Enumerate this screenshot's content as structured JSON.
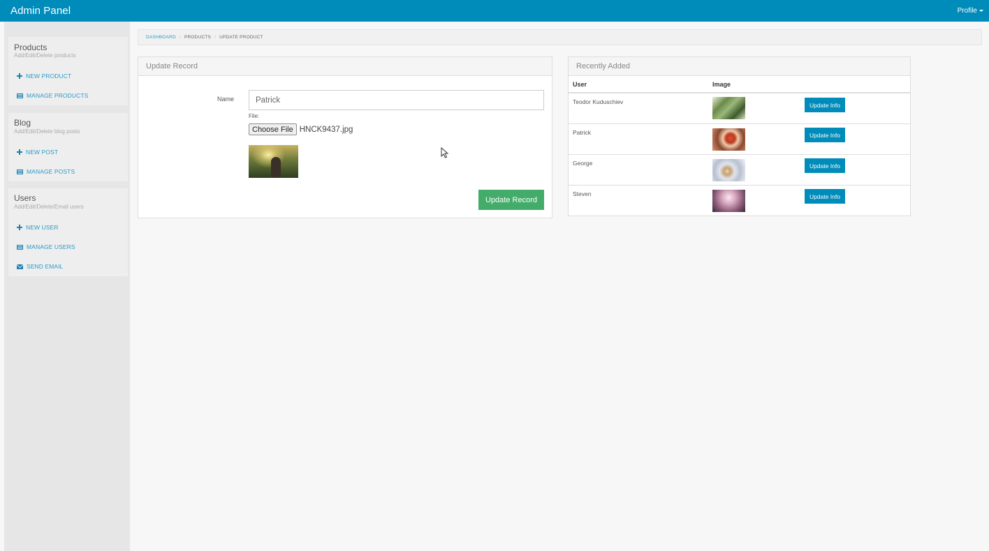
{
  "topbar": {
    "brand": "Admin Panel",
    "profile": "Profile"
  },
  "sidebar": {
    "sections": [
      {
        "title": "Products",
        "subtitle": "Add/Edit/Delete products",
        "links": [
          {
            "label": "NEW PRODUCT",
            "icon": "plus-icon"
          },
          {
            "label": "MANAGE PRODUCTS",
            "icon": "list-icon"
          }
        ]
      },
      {
        "title": "Blog",
        "subtitle": "Add/Edit/Delete blog posts",
        "links": [
          {
            "label": "NEW POST",
            "icon": "plus-icon"
          },
          {
            "label": "MANAGE POSTS",
            "icon": "list-icon"
          }
        ]
      },
      {
        "title": "Users",
        "subtitle": "Add/Edit/Delete/Email users",
        "links": [
          {
            "label": "NEW USER",
            "icon": "plus-icon"
          },
          {
            "label": "MANAGE USERS",
            "icon": "list-icon"
          },
          {
            "label": "SEND EMAIL",
            "icon": "envelope-icon"
          }
        ]
      }
    ]
  },
  "breadcrumb": {
    "items": [
      "DASHBOARD",
      "PRODUCTS",
      "UPDATE PRODUCT"
    ]
  },
  "update_form": {
    "title": "Update Record",
    "name_label": "Name",
    "name_value": "Patrick",
    "file_label": "File:",
    "choose_file": "Choose File",
    "file_name": "HNCK9437.jpg",
    "submit": "Update Record"
  },
  "recent": {
    "title": "Recently Added",
    "columns": [
      "User",
      "Image"
    ],
    "rows": [
      {
        "user": "Teodor Kuduschiev",
        "button": "Update Info"
      },
      {
        "user": "Patrick",
        "button": "Update Info"
      },
      {
        "user": "George",
        "button": "Update Info"
      },
      {
        "user": "Steven",
        "button": "Update Info"
      }
    ]
  },
  "colors": {
    "primary": "#008cba",
    "success": "#43ac6a"
  }
}
